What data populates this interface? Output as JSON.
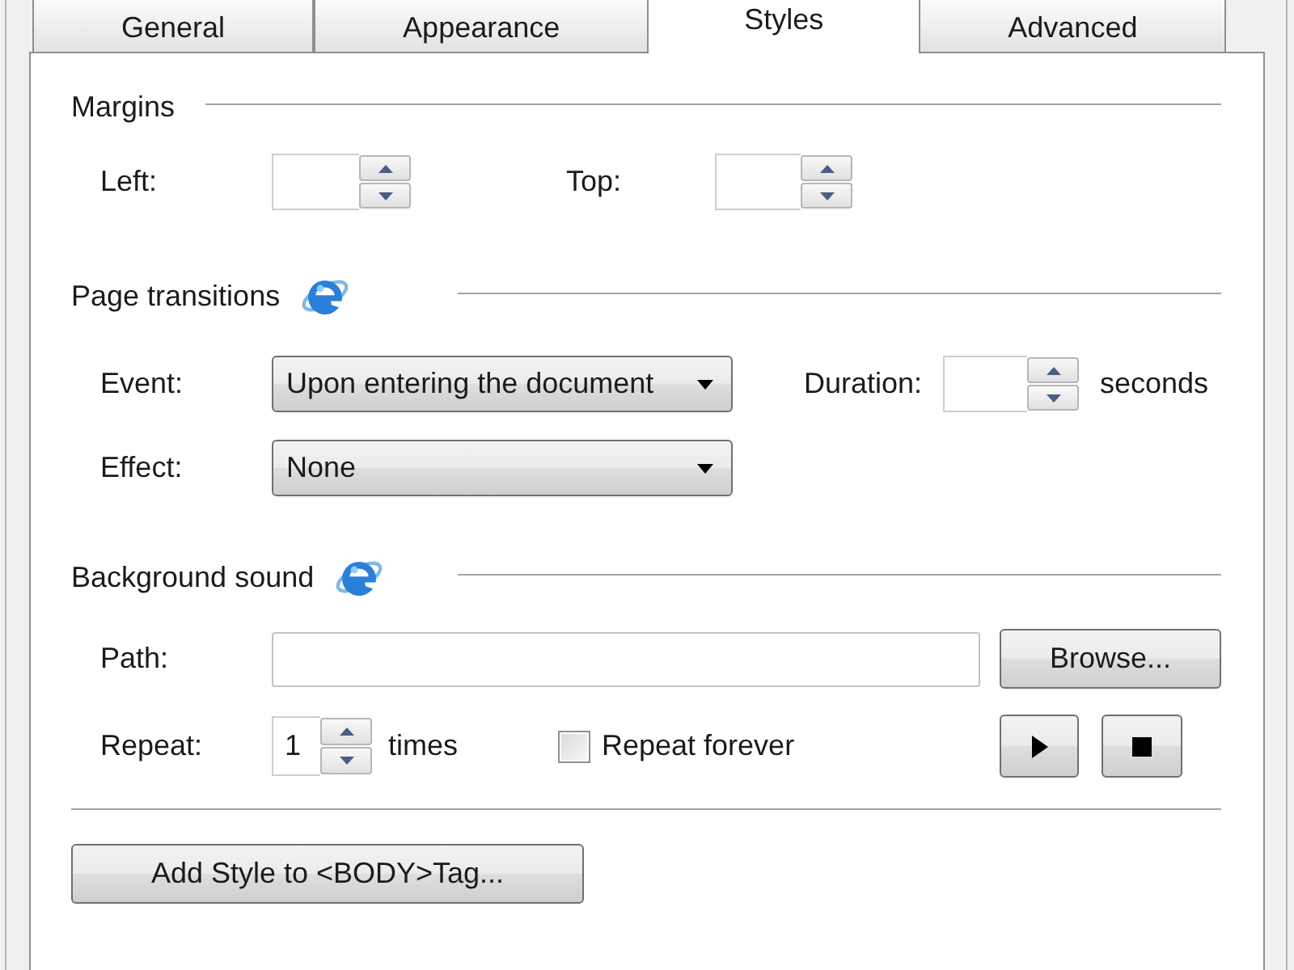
{
  "tabs": [
    {
      "label": "General",
      "selected": false
    },
    {
      "label": "Appearance",
      "selected": false
    },
    {
      "label": "Styles",
      "selected": true
    },
    {
      "label": "Advanced",
      "selected": false
    }
  ],
  "margins": {
    "title": "Margins",
    "left": {
      "label": "Left:"
    },
    "top": {
      "label": "Top:"
    }
  },
  "page_transitions": {
    "title": "Page transitions",
    "event": {
      "label": "Event:",
      "value": "Upon entering the document"
    },
    "duration": {
      "label": "Duration:",
      "unit": "seconds"
    },
    "effect": {
      "label": "Effect:",
      "value": "None"
    }
  },
  "background_sound": {
    "title": "Background sound",
    "path": {
      "label": "Path:"
    },
    "browse_button": "Browse...",
    "repeat": {
      "label": "Repeat:",
      "value": "1",
      "unit": "times"
    },
    "repeat_forever": {
      "label": "Repeat forever",
      "checked": false
    }
  },
  "add_style_button": "Add Style to <BODY>Tag..."
}
